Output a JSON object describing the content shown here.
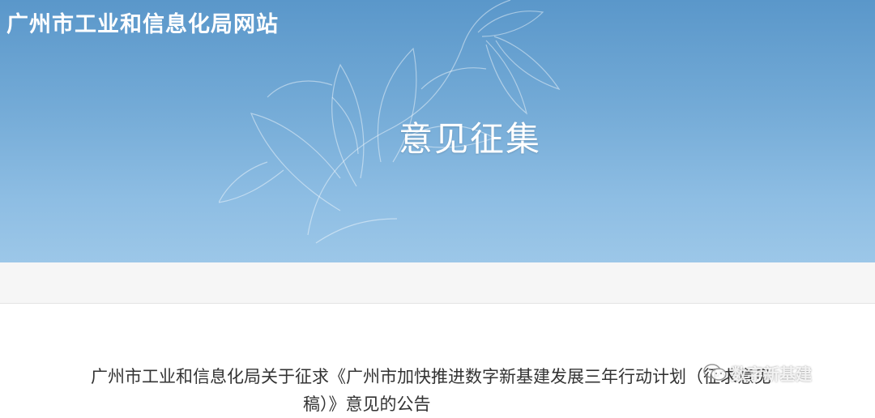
{
  "header": {
    "site_title": "广州市工业和信息化局网站",
    "page_heading": "意见征集"
  },
  "notice": {
    "title_line1": "广州市工业和信息化局关于征求《广州市加快推进数字新基建发展三年行动计划（征求意见",
    "title_line2": "稿）》意见的公告"
  },
  "watermark": {
    "text": "数字新基建",
    "icon": "wechat-icon"
  },
  "colors": {
    "banner_top": "#5a97ca",
    "banner_bottom": "#9cc7e8",
    "text": "#333333"
  }
}
